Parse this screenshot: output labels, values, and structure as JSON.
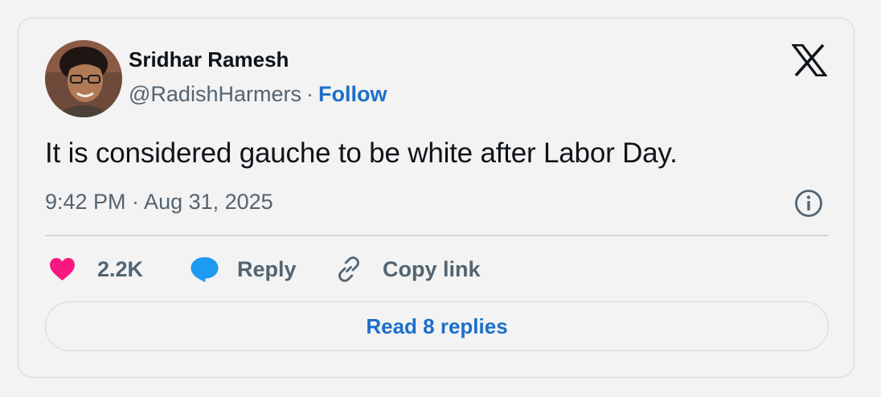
{
  "author": {
    "name": "Sridhar Ramesh",
    "handle": "@RadishHarmers",
    "separator": "·",
    "follow_label": "Follow",
    "avatar": "profile-photo-avatar"
  },
  "brand": {
    "logo": "x-logo-icon"
  },
  "tweet": {
    "text": "It is considered gauche to be white after Labor Day.",
    "timestamp": "9:42 PM · Aug 31, 2025"
  },
  "actions": {
    "like": {
      "count": "2.2K",
      "icon": "heart-icon",
      "color": "#f91880"
    },
    "reply": {
      "label": "Reply",
      "icon": "speech-bubble-icon",
      "color": "#1d9bf0"
    },
    "copy_link": {
      "label": "Copy link",
      "icon": "link-icon"
    }
  },
  "read_replies_label": "Read 8 replies",
  "colors": {
    "link": "#1d6fc9",
    "text_primary": "#0f1419",
    "text_secondary": "#536471",
    "border": "#cfd9de",
    "background": "#f3f3f3"
  }
}
